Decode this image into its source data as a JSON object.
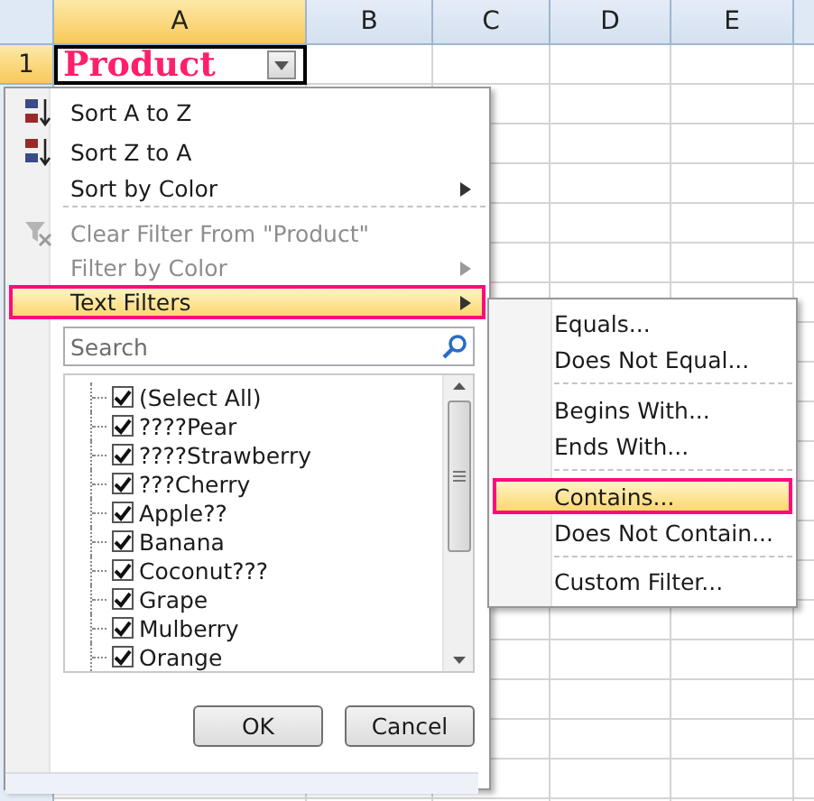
{
  "sheet": {
    "columns": [
      {
        "label": "A",
        "selected": true
      },
      {
        "label": "B",
        "selected": false
      },
      {
        "label": "C",
        "selected": false
      },
      {
        "label": "D",
        "selected": false
      },
      {
        "label": "E",
        "selected": false
      }
    ],
    "row_label": "1",
    "cell_value": "Product"
  },
  "menu": {
    "items": [
      {
        "kind": "ascending",
        "label": "Sort A to Z",
        "disabled": false,
        "selected": false,
        "submenu": false
      },
      {
        "kind": "descending",
        "label": "Sort Z to A",
        "disabled": false,
        "selected": false,
        "submenu": false
      },
      {
        "kind": "item",
        "label": "Sort by Color",
        "disabled": false,
        "selected": false,
        "submenu": true
      },
      {
        "kind": "separator"
      },
      {
        "kind": "clearing",
        "label": "Clear Filter From \"Product\"",
        "disabled": true,
        "selected": false,
        "submenu": false
      },
      {
        "kind": "item",
        "label": "Filter by Color",
        "disabled": true,
        "selected": false,
        "submenu": true
      },
      {
        "kind": "item",
        "label": "Text Filters",
        "disabled": false,
        "selected": true,
        "submenu": true
      }
    ],
    "search": {
      "placeholder": "Search"
    },
    "values": [
      {
        "label": "(Select All)",
        "checked": true
      },
      {
        "label": "????Pear",
        "checked": true
      },
      {
        "label": "????Strawberry",
        "checked": true
      },
      {
        "label": "???Cherry",
        "checked": true
      },
      {
        "label": "Apple??",
        "checked": true
      },
      {
        "label": "Banana",
        "checked": true
      },
      {
        "label": "Coconut???",
        "checked": true
      },
      {
        "label": "Grape",
        "checked": true
      },
      {
        "label": "Mulberry",
        "checked": true
      },
      {
        "label": "Orange",
        "checked": true
      }
    ],
    "buttons": [
      "OK",
      "Cancel"
    ]
  },
  "submenu": {
    "items": [
      {
        "kind": "item",
        "label": "Equals...",
        "selected": false
      },
      {
        "kind": "item",
        "label": "Does Not Equal...",
        "selected": false
      },
      {
        "kind": "separator"
      },
      {
        "kind": "item",
        "label": "Begins With...",
        "selected": false
      },
      {
        "kind": "item",
        "label": "Ends With...",
        "selected": false
      },
      {
        "kind": "separator"
      },
      {
        "kind": "item",
        "label": "Contains...",
        "selected": true
      },
      {
        "kind": "item",
        "label": "Does Not Contain...",
        "selected": false
      },
      {
        "kind": "separator"
      },
      {
        "kind": "item",
        "label": "Custom Filter...",
        "selected": false
      }
    ]
  }
}
